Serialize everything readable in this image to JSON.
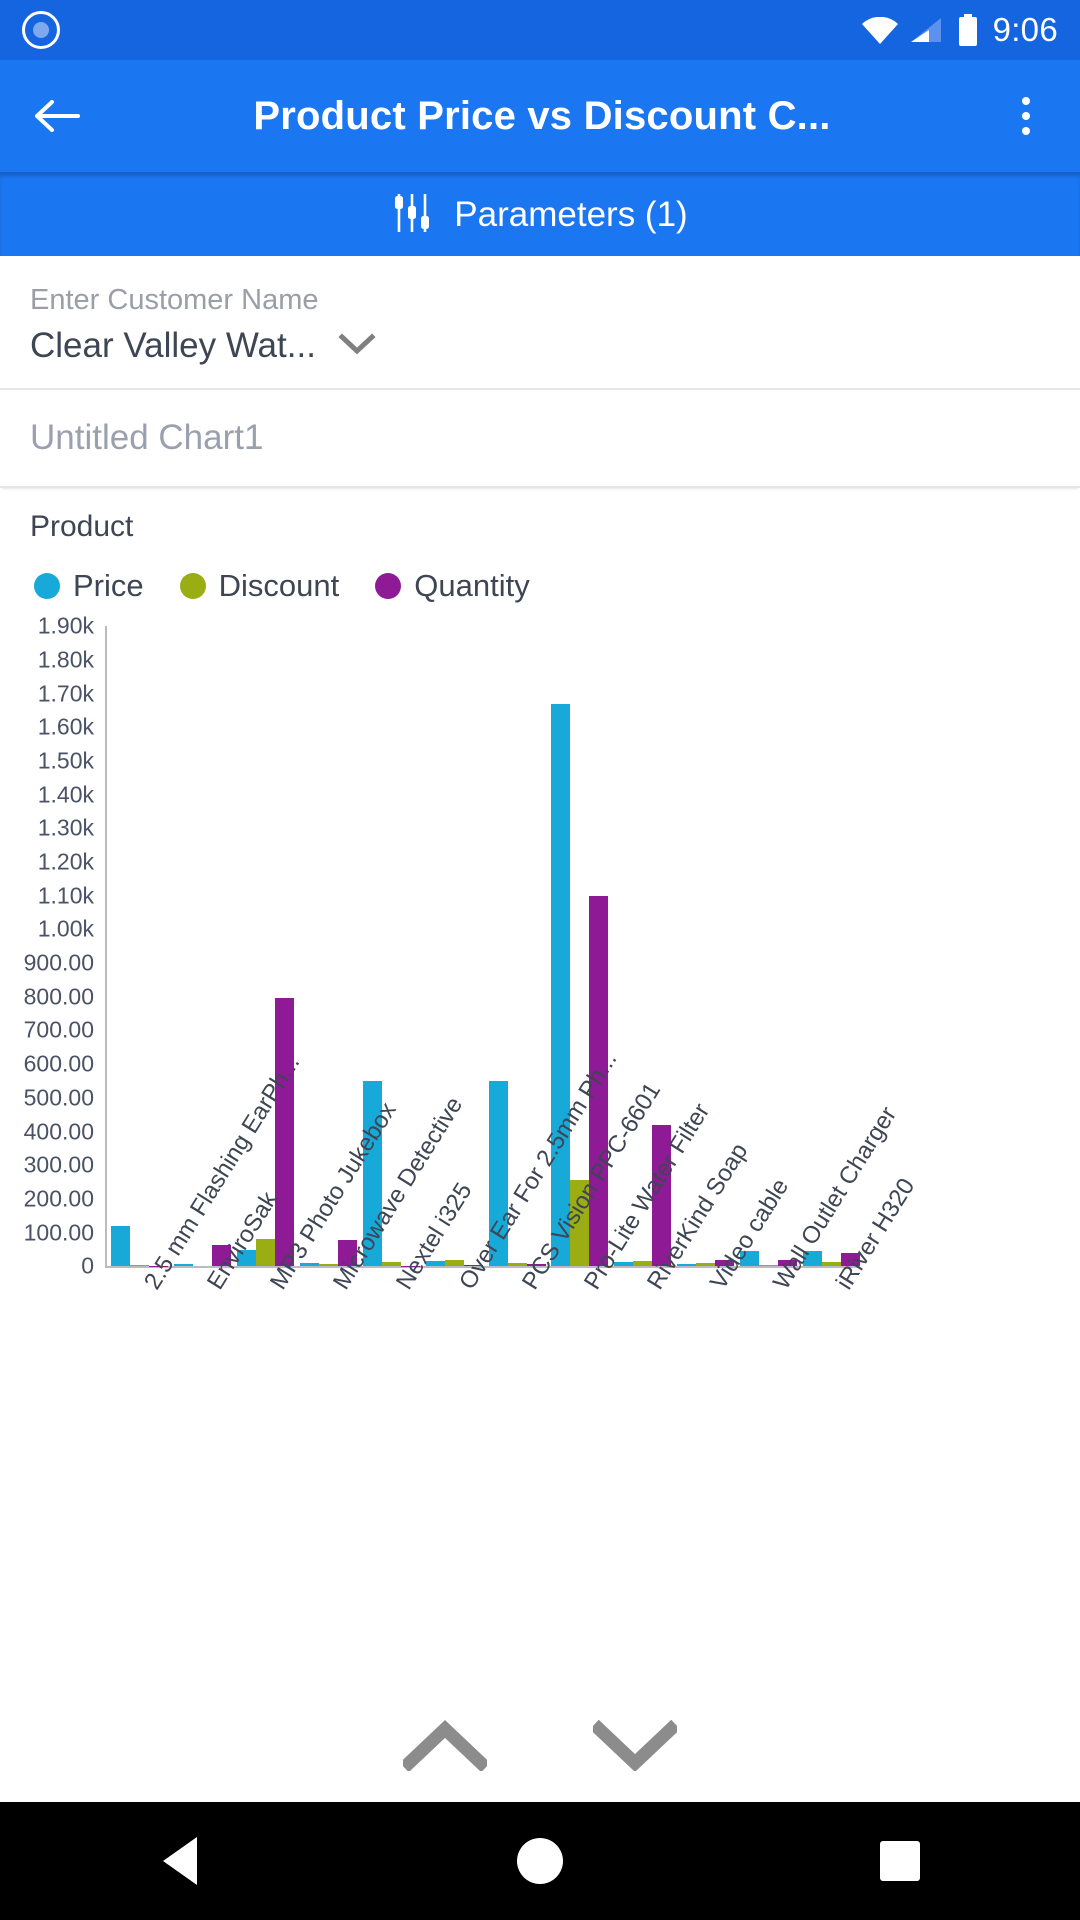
{
  "statusbar": {
    "time": "9:06",
    "icons": [
      "app-indicator-icon",
      "wifi-icon",
      "cellular-signal-icon",
      "battery-icon"
    ]
  },
  "toolbar": {
    "title": "Product Price vs Discount C...",
    "back_icon": "back-arrow-icon",
    "overflow_icon": "overflow-menu-icon"
  },
  "params_bar": {
    "label": "Parameters (1)",
    "icon": "sliders-icon"
  },
  "parameter": {
    "caption": "Enter Customer Name",
    "value": "Clear Valley Wat...",
    "dropdown_icon": "chevron-down-icon"
  },
  "chart_title_field": {
    "value": "Untitled Chart1"
  },
  "pager": {
    "up_icon": "chevron-up-icon",
    "down_icon": "chevron-down-icon"
  },
  "navbar": {
    "back": "nav-back-triangle",
    "home": "nav-home-circle",
    "recents": "nav-recents-square"
  },
  "colors": {
    "status_bar": "#1565e0",
    "toolbar": "#1b76f2",
    "price": "#17a9d8",
    "discount": "#9aad12",
    "quantity": "#8e1a96",
    "axis": "#b9bcc4",
    "text": "#3e4654"
  },
  "chart_data": {
    "type": "bar",
    "title": "Untitled Chart1",
    "xlabel": "Product",
    "ylabel": "",
    "grid": false,
    "legend_position": "top-left",
    "ylim": [
      0,
      1900
    ],
    "ytick_labels": [
      "1.90k",
      "1.80k",
      "1.70k",
      "1.60k",
      "1.50k",
      "1.40k",
      "1.30k",
      "1.20k",
      "1.10k",
      "1.00k",
      "900.00",
      "800.00",
      "700.00",
      "600.00",
      "500.00",
      "400.00",
      "300.00",
      "200.00",
      "100.00",
      "0"
    ],
    "ytick_values": [
      1900,
      1800,
      1700,
      1600,
      1500,
      1400,
      1300,
      1200,
      1100,
      1000,
      900,
      800,
      700,
      600,
      500,
      400,
      300,
      200,
      100,
      0
    ],
    "categories": [
      "2.5 mm Flashing EarPh...",
      "EnviroSak",
      "MP3 Photo Jukebox",
      "Microwave Detective",
      "Nextel i325",
      "Over Ear For 2.5mm Ph...",
      "PCS Vision PPC-6601",
      "Pro-Lite Water Filter",
      "RiverKind Soap",
      "Video cable",
      "Wall Outlet Charger",
      "iRiver H320"
    ],
    "series": [
      {
        "name": "Price",
        "color": "#17a9d8",
        "values": [
          120,
          8,
          48,
          10,
          550,
          15,
          550,
          1670,
          12,
          7,
          46,
          45
        ]
      },
      {
        "name": "Discount",
        "color": "#9aad12",
        "values": [
          4,
          0,
          82,
          8,
          12,
          18,
          10,
          255,
          16,
          9,
          3,
          12
        ]
      },
      {
        "name": "Quantity",
        "color": "#8e1a96",
        "values": [
          2,
          63,
          795,
          78,
          2,
          4,
          6,
          1100,
          418,
          20,
          20,
          38
        ]
      }
    ]
  }
}
